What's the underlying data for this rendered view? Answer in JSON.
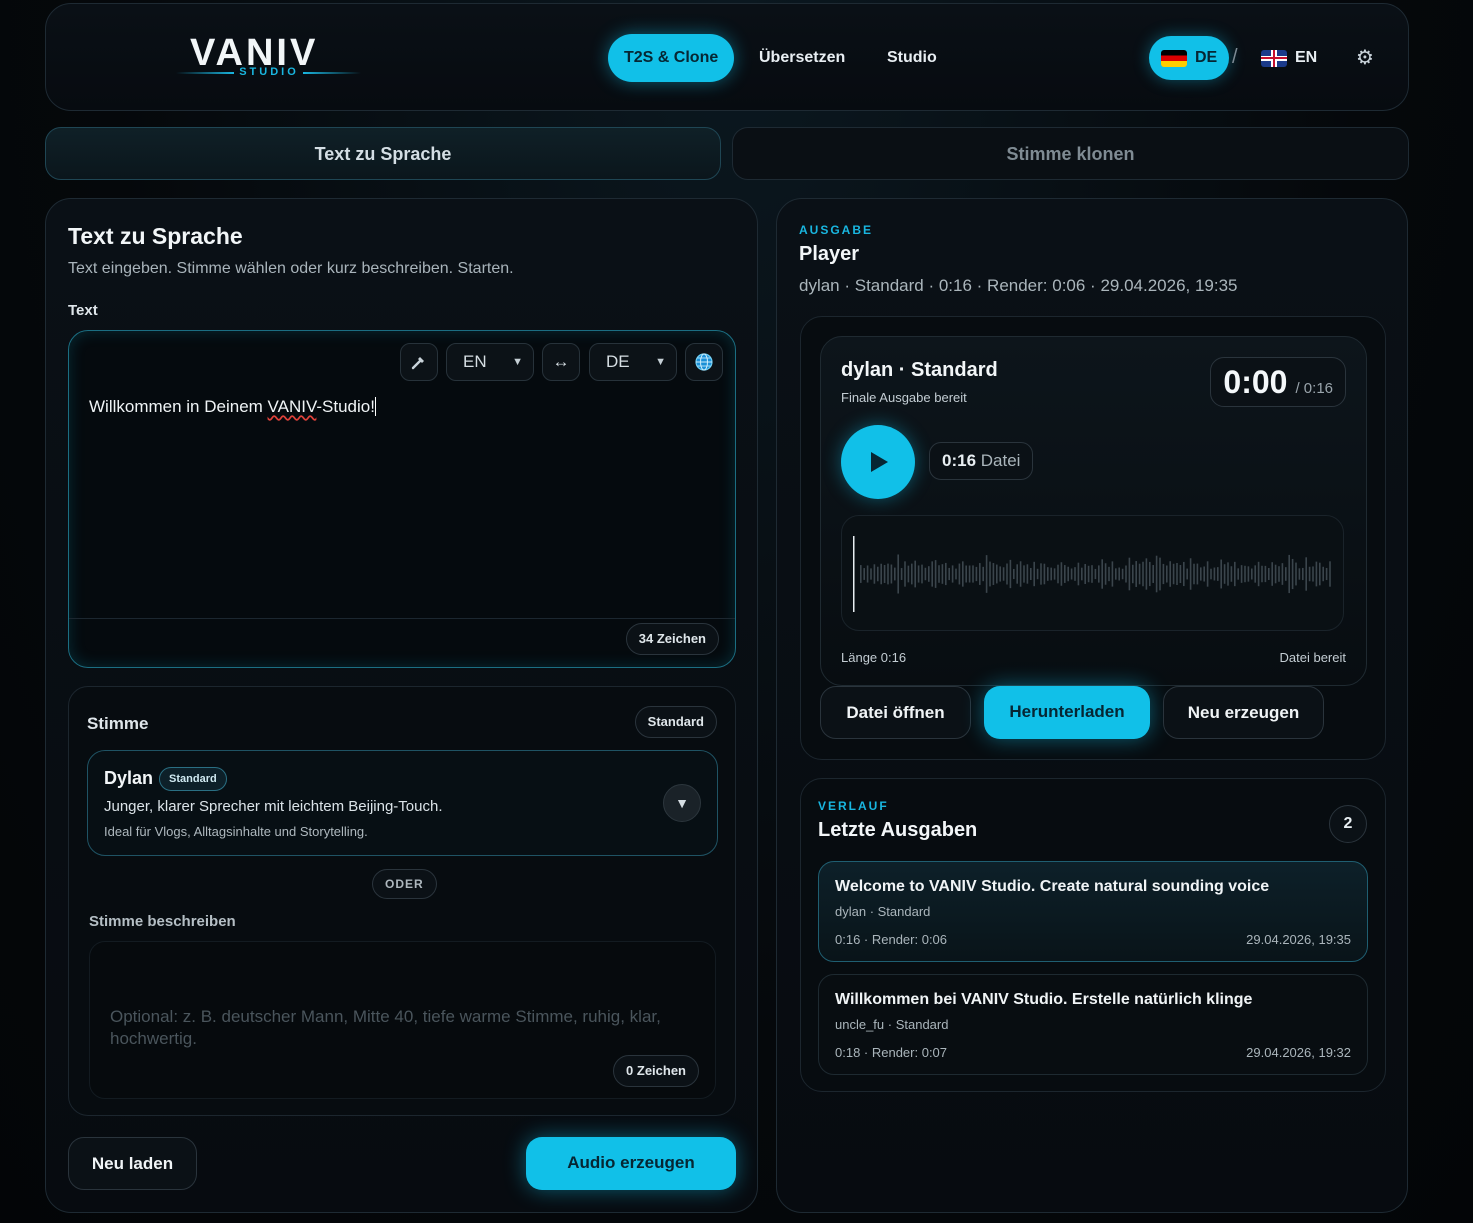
{
  "brand": {
    "name": "VANIV",
    "sub": "STUDIO"
  },
  "nav": [
    {
      "label": "T2S & Clone"
    },
    {
      "label": "Übersetzen"
    },
    {
      "label": "Studio"
    }
  ],
  "langs": {
    "de": "DE",
    "separator": "/",
    "en": "EN"
  },
  "settings_icon": "gear-icon",
  "tabs": {
    "tts": "Text zu Sprache",
    "clone": "Stimme klonen"
  },
  "left": {
    "title": "Text zu Sprache",
    "subtitle": "Text eingeben. Stimme wählen oder kurz beschreiben. Starten.",
    "text_label": "Text",
    "source_lang": "EN",
    "swap_icon": "↔",
    "target_lang": "DE",
    "text_before": "Willkommen in Deinem ",
    "text_spell": "VANIV",
    "text_after": "-Studio!",
    "char_count": "34 Zeichen",
    "voice": {
      "label": "Stimme",
      "mode_badge": "Standard",
      "name": "Dylan",
      "name_badge": "Standard",
      "desc": "Junger, klarer Sprecher mit leichtem Beijing-Touch.",
      "hint": "Ideal für Vlogs, Alltagsinhalte und Storytelling.",
      "or": "ODER",
      "describe_label": "Stimme beschreiben",
      "describe_placeholder": "Optional: z. B. deutscher Mann, Mitte 40, tiefe warme Stimme, ruhig, klar, hochwertig.",
      "describe_count": "0 Zeichen"
    },
    "reload_button": "Neu laden",
    "generate_button": "Audio erzeugen"
  },
  "output": {
    "eyebrow": "AUSGABE",
    "title": "Player",
    "meta": "dylan · Standard · 0:16 · Render: 0:06 · 29.04.2026, 19:35",
    "player": {
      "title": "dylan · Standard",
      "status": "Finale Ausgabe bereit",
      "current": "0:00",
      "total": "/ 0:16",
      "duration": "0:16",
      "duration_suffix": "Datei",
      "length_label": "Länge 0:16",
      "ready_label": "Datei bereit",
      "progress": 0
    },
    "buttons": {
      "open": "Datei öffnen",
      "download": "Herunterladen",
      "regenerate": "Neu erzeugen"
    }
  },
  "history": {
    "eyebrow": "VERLAUF",
    "title": "Letzte Ausgaben",
    "count": "2",
    "items": [
      {
        "title": "Welcome to VANIV Studio. Create natural sounding voice",
        "meta": "dylan · Standard",
        "left": "0:16 · Render: 0:06",
        "right": "29.04.2026, 19:35"
      },
      {
        "title": "Willkommen bei VANIV Studio. Erstelle natürlich klinge",
        "meta": "uncle_fu · Standard",
        "left": "0:18 · Render: 0:07",
        "right": "29.04.2026, 19:32"
      }
    ]
  },
  "colors": {
    "accent": "#11c0e8",
    "bg": "#05080b",
    "panel": "#0a1016"
  }
}
